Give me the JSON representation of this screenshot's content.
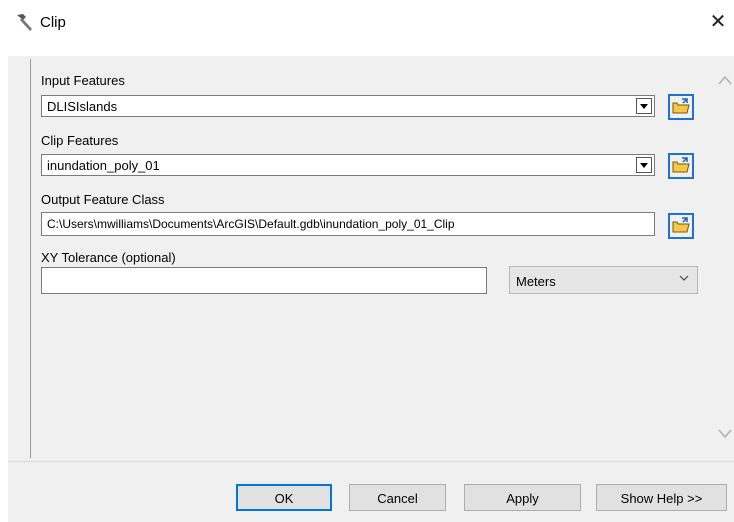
{
  "window": {
    "title": "Clip",
    "title_icon": "hammer-icon",
    "close_label": "✕"
  },
  "form": {
    "input_features": {
      "label": "Input Features",
      "value": "DLISIslands"
    },
    "clip_features": {
      "label": "Clip Features",
      "value": "inundation_poly_01"
    },
    "output_feature_class": {
      "label": "Output Feature Class",
      "value": "C:\\Users\\mwilliams\\Documents\\ArcGIS\\Default.gdb\\inundation_poly_01_Clip"
    },
    "xy_tolerance": {
      "label": "XY Tolerance (optional)",
      "value": "",
      "units": "Meters"
    }
  },
  "buttons": {
    "ok": "OK",
    "cancel": "Cancel",
    "apply": "Apply",
    "show_help": "Show Help >>"
  },
  "colors": {
    "accent": "#0078d7",
    "folder": "#f2c94c"
  }
}
